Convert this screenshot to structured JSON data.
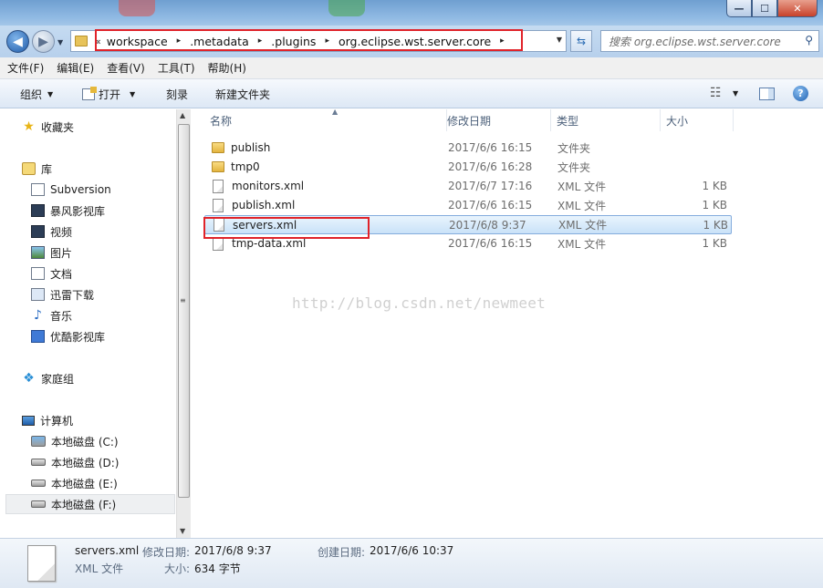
{
  "window": {
    "minimize_label": "—",
    "maximize_label": "☐",
    "close_label": "✕"
  },
  "address_bar": {
    "leading_chevron": "«",
    "crumbs": [
      "workspace",
      ".metadata",
      ".plugins",
      "org.eclipse.wst.server.core"
    ],
    "separator": "▸"
  },
  "search": {
    "placeholder": "搜索 org.eclipse.wst.server.core"
  },
  "menu": [
    "文件(F)",
    "编辑(E)",
    "查看(V)",
    "工具(T)",
    "帮助(H)"
  ],
  "toolbar": {
    "organize": "组织",
    "open": "打开",
    "burn": "刻录",
    "new_folder": "新建文件夹"
  },
  "nav": {
    "favorites": "收藏夹",
    "libraries": "库",
    "library_items": [
      "Subversion",
      "暴风影视库",
      "视频",
      "图片",
      "文档",
      "迅雷下载",
      "音乐",
      "优酷影视库"
    ],
    "homegroup": "家庭组",
    "computer": "计算机",
    "drives": [
      "本地磁盘 (C:)",
      "本地磁盘 (D:)",
      "本地磁盘 (E:)",
      "本地磁盘 (F:)"
    ],
    "selected_drive": "本地磁盘 (F:)"
  },
  "columns": {
    "name": "名称",
    "date": "修改日期",
    "type": "类型",
    "size": "大小"
  },
  "files": [
    {
      "name": "publish",
      "date": "2017/6/6 16:15",
      "type": "文件夹",
      "size": "",
      "kind": "folder"
    },
    {
      "name": "tmp0",
      "date": "2017/6/6 16:28",
      "type": "文件夹",
      "size": "",
      "kind": "folder"
    },
    {
      "name": "monitors.xml",
      "date": "2017/6/7 17:16",
      "type": "XML 文件",
      "size": "1 KB",
      "kind": "file"
    },
    {
      "name": "publish.xml",
      "date": "2017/6/6 16:15",
      "type": "XML 文件",
      "size": "1 KB",
      "kind": "file"
    },
    {
      "name": "servers.xml",
      "date": "2017/6/8 9:37",
      "type": "XML 文件",
      "size": "1 KB",
      "kind": "file",
      "selected": true
    },
    {
      "name": "tmp-data.xml",
      "date": "2017/6/6 16:15",
      "type": "XML 文件",
      "size": "1 KB",
      "kind": "file"
    }
  ],
  "watermark": "http://blog.csdn.net/newmeet",
  "details": {
    "file_name": "servers.xml",
    "file_type": "XML 文件",
    "modified_label": "修改日期:",
    "modified_value": "2017/6/8 9:37",
    "created_label": "创建日期:",
    "created_value": "2017/6/6 10:37",
    "size_label": "大小:",
    "size_value": "634 字节"
  },
  "colors": {
    "highlight_box": "#e0232a",
    "selection_fill": "#c9e2f8",
    "titlebar": "#8eb8e2"
  }
}
